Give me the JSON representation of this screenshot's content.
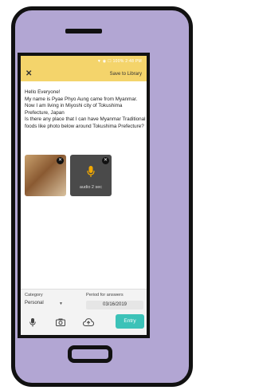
{
  "status_bar": {
    "text": "▼ ◉ ☐ 100% 2:48 PM"
  },
  "header": {
    "close_icon": "close-icon",
    "save_label": "Save to Library"
  },
  "message": {
    "lines": [
      "Hello Everyone!",
      "My name is Pyae Phyo Aung came from Myanmar.",
      "Now I am living in Miyoshi city of Tokushima",
      "Prefecture, Japan",
      "Is there any place that I can have Myanmar Traditional",
      "foods like photo below around Tokushima Prefecture?"
    ]
  },
  "attachments": {
    "audio_label": "audio 2 sec"
  },
  "form": {
    "category_label": "Category",
    "category_value": "Personal",
    "period_label": "Period for answers",
    "period_value": "03/16/2019"
  },
  "actions": {
    "entry_label": "Entry"
  },
  "colors": {
    "accent": "#3cc2b8",
    "header": "#f4d46b",
    "phone": "#b2a6d3"
  }
}
